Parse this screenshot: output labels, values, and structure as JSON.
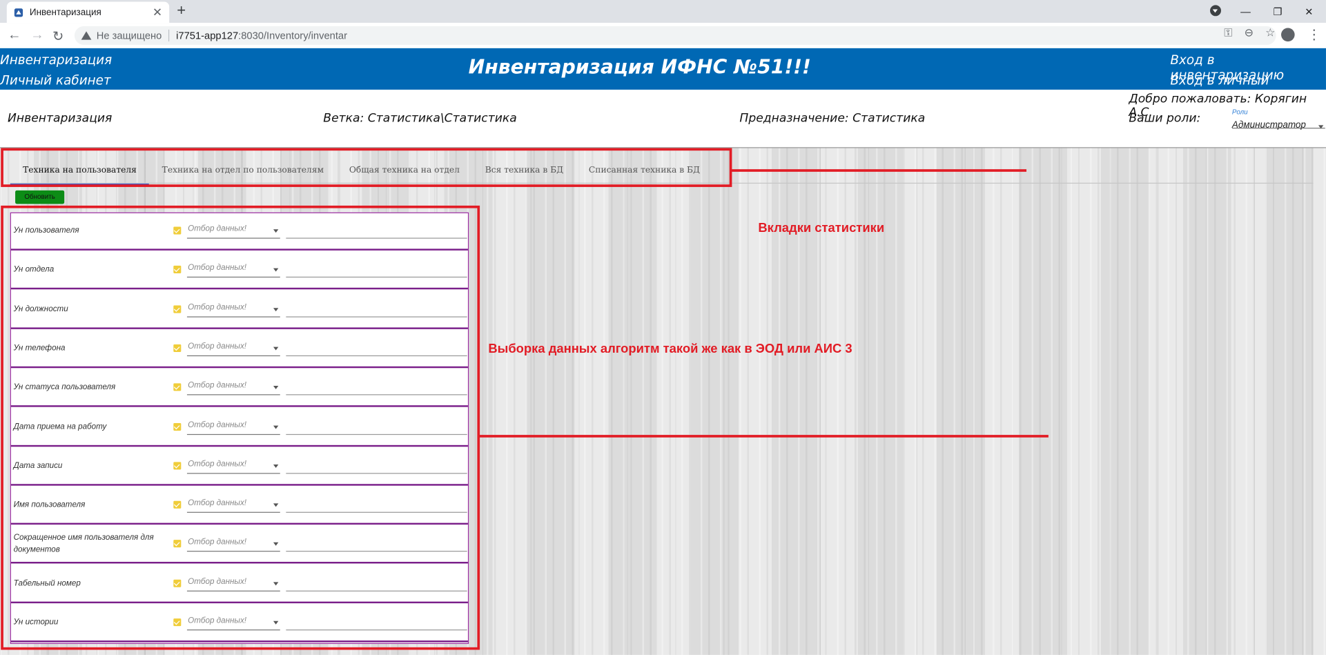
{
  "browser": {
    "tab_title": "Инвентаризация",
    "new_tab": "+",
    "tab_close": "✕",
    "controls": {
      "minimize": "—",
      "restore": "❐",
      "close": "✕"
    },
    "back": "←",
    "forward": "→",
    "reload": "↻",
    "security_label": "Не защищено",
    "url_host": "i7751-app127",
    "url_rest": ":8030/Inventory/inventar",
    "omni_icons": {
      "key": "⚿",
      "zoom": "⊖",
      "star": "☆"
    },
    "menu": "⋮"
  },
  "header": {
    "left_link_1": "Инвентаризация",
    "left_link_2": "Личный кабинет",
    "title": "Инвентаризация ИФНС №51!!!",
    "right_link_1": "Вход в инвентаризацию",
    "right_link_2": "Вход в личный кабинет"
  },
  "info": {
    "section": "Инвентаризация",
    "branch": "Ветка: Статистика\\Статистика",
    "purpose": "Предназначение: Статистика",
    "welcome": "Добро пожаловать: Корягин А.С.",
    "roles_label": "Ваши роли:",
    "roles_small": "Роли",
    "roles_value": "Администратор"
  },
  "tabs": [
    {
      "label": "Техника на пользователя",
      "active": true
    },
    {
      "label": "Техника на отдел по пользователям",
      "active": false
    },
    {
      "label": "Общая техника на отдел",
      "active": false
    },
    {
      "label": "Вся техника в БД",
      "active": false
    },
    {
      "label": "Списанная техника в БД",
      "active": false
    }
  ],
  "refresh_label": "Обновить",
  "filter_placeholder": "Отбор данных!",
  "filters": [
    "Ун пользователя",
    "Ун отдела",
    "Ун должности",
    "Ун телефона",
    "Ун статуса пользователя",
    "Дата приема на работу",
    "Дата записи",
    "Имя пользователя",
    "Сокращенное имя пользователя для документов",
    "Табельный номер",
    "Ун истории"
  ],
  "annotations": {
    "tabs_note": "Вкладки статистики",
    "filter_note": "Выборка данных алгоритм такой же как в ЭОД или АИС 3"
  },
  "colors": {
    "header_bg": "#0068b4",
    "annotation_red": "#e21c25",
    "refresh_green": "#0c8c16",
    "row_border": "#7a1f8a"
  }
}
